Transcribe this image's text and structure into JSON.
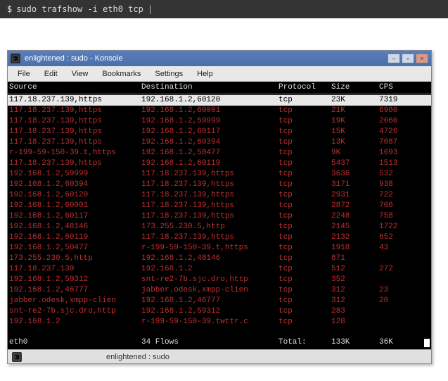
{
  "command": {
    "prompt": "$",
    "text": "sudo trafshow -i eth0 tcp",
    "cursor": "|"
  },
  "window": {
    "title": "enlightened : sudo - Konsole"
  },
  "menu": [
    "File",
    "Edit",
    "View",
    "Bookmarks",
    "Settings",
    "Help"
  ],
  "headers": {
    "src": "Source",
    "dst": "Destination",
    "proto": "Protocol",
    "size": "Size",
    "cps": "CPS"
  },
  "rows": [
    {
      "src": "117.18.237.139,https",
      "dst": "192.168.1.2,60120",
      "proto": "tcp",
      "size": "23K",
      "cps": "7319",
      "hl": true
    },
    {
      "src": "117.18.237.139,https",
      "dst": "192.168.1.2,60001",
      "proto": "tcp",
      "size": "21K",
      "cps": "6980"
    },
    {
      "src": "117.18.237.139,https",
      "dst": "192.168.1.2,59999",
      "proto": "tcp",
      "size": "19K",
      "cps": "2060"
    },
    {
      "src": "117.18.237.139,https",
      "dst": "192.168.1.2,60117",
      "proto": "tcp",
      "size": "15K",
      "cps": "4726"
    },
    {
      "src": "117.18.237.139,https",
      "dst": "192.168.1.2,60394",
      "proto": "tcp",
      "size": "13K",
      "cps": "7087"
    },
    {
      "src": "r-199-59-150-39.t,https",
      "dst": "192.168.1.2,50477",
      "proto": "tcp",
      "size": "9K",
      "cps": "1693"
    },
    {
      "src": "117.18.237.139,https",
      "dst": "192.168.1.2,60119",
      "proto": "tcp",
      "size": "5437",
      "cps": "1513"
    },
    {
      "src": "192.168.1.2,59999",
      "dst": "117.18.237.139,https",
      "proto": "tcp",
      "size": "3636",
      "cps": "532"
    },
    {
      "src": "192.168.1.2,60394",
      "dst": "117.18.237.139,https",
      "proto": "tcp",
      "size": "3171",
      "cps": "938"
    },
    {
      "src": "192.168.1.2,60120",
      "dst": "117.18.237.139,https",
      "proto": "tcp",
      "size": "2931",
      "cps": "722"
    },
    {
      "src": "192.168.1.2,60001",
      "dst": "117.18.237.139,https",
      "proto": "tcp",
      "size": "2872",
      "cps": "706"
    },
    {
      "src": "192.168.1.2,60117",
      "dst": "117.18.237.139,https",
      "proto": "tcp",
      "size": "2248",
      "cps": "758"
    },
    {
      "src": "192.168.1.2,48146",
      "dst": "173.255.230.5,http",
      "proto": "tcp",
      "size": "2145",
      "cps": "1722"
    },
    {
      "src": "192.168.1.2,60119",
      "dst": "117.18.237.139,https",
      "proto": "tcp",
      "size": "2132",
      "cps": "652"
    },
    {
      "src": "192.168.1.2,50477",
      "dst": "r-199-59-150-39.t,https",
      "proto": "tcp",
      "size": "1918",
      "cps": "43"
    },
    {
      "src": "173.255.230.5,http",
      "dst": "192.168.1.2,48146",
      "proto": "tcp",
      "size": "871",
      "cps": ""
    },
    {
      "src": "117.18.237.139",
      "dst": "192.168.1.2",
      "proto": "tcp",
      "size": "512",
      "cps": "272"
    },
    {
      "src": "192.168.1.2,59312",
      "dst": "snt-re2-7b.sjc.dro,http",
      "proto": "tcp",
      "size": "352",
      "cps": ""
    },
    {
      "src": "192.168.1.2,46777",
      "dst": "jabber.odesk,xmpp-clien",
      "proto": "tcp",
      "size": "312",
      "cps": "23"
    },
    {
      "src": "jabber.odesk,xmpp-clien",
      "dst": "192.168.1.2,46777",
      "proto": "tcp",
      "size": "312",
      "cps": "20"
    },
    {
      "src": "snt-re2-7b.sjc.dro,http",
      "dst": "192.168.1.2,59312",
      "proto": "tcp",
      "size": "283",
      "cps": ""
    },
    {
      "src": "192.168.1.2",
      "dst": "r-199-59-150-39.twttr.c",
      "proto": "tcp",
      "size": "128",
      "cps": ""
    }
  ],
  "footer": {
    "iface": "eth0",
    "flows": "34 Flows",
    "total_label": "Total:",
    "size": "133K",
    "cps": "36K"
  },
  "status": {
    "text": "enlightened : sudo"
  }
}
